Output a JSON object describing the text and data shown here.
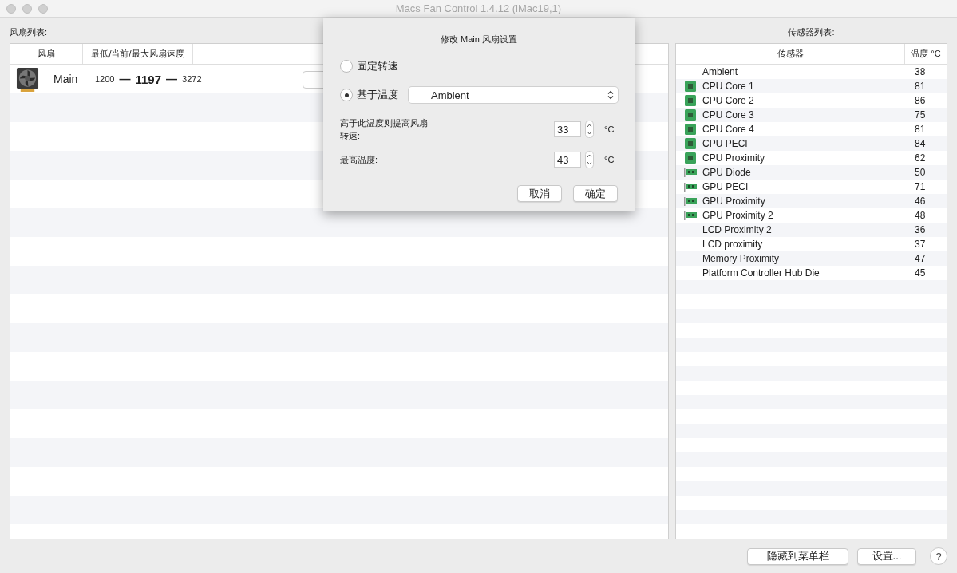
{
  "window": {
    "title": "Macs Fan Control 1.4.12 (iMac19,1)"
  },
  "fan_list": {
    "label": "风扇列表:",
    "columns": [
      "风扇",
      "最低/当前/最大风扇速度"
    ],
    "rows": [
      {
        "name": "Main",
        "min": "1200",
        "current": "1197",
        "max": "3272",
        "separator_1": "—",
        "separator_2": "—"
      }
    ]
  },
  "sensor_list": {
    "label": "传感器列表:",
    "columns": [
      "传感器",
      "温度 °C"
    ],
    "rows": [
      {
        "kind": "plain",
        "name": "Ambient",
        "value": "38"
      },
      {
        "kind": "cpu",
        "name": "CPU Core 1",
        "value": "81"
      },
      {
        "kind": "cpu",
        "name": "CPU Core 2",
        "value": "86"
      },
      {
        "kind": "cpu",
        "name": "CPU Core 3",
        "value": "75"
      },
      {
        "kind": "cpu",
        "name": "CPU Core 4",
        "value": "81"
      },
      {
        "kind": "cpu",
        "name": "CPU PECI",
        "value": "84"
      },
      {
        "kind": "cpu",
        "name": "CPU Proximity",
        "value": "62"
      },
      {
        "kind": "gpu",
        "name": "GPU Diode",
        "value": "50"
      },
      {
        "kind": "gpu",
        "name": "GPU PECI",
        "value": "71"
      },
      {
        "kind": "gpu",
        "name": "GPU Proximity",
        "value": "46"
      },
      {
        "kind": "gpu",
        "name": "GPU Proximity 2",
        "value": "48"
      },
      {
        "kind": "plain",
        "name": "LCD Proximity 2",
        "value": "36"
      },
      {
        "kind": "plain",
        "name": "LCD proximity",
        "value": "37"
      },
      {
        "kind": "plain",
        "name": "Memory Proximity",
        "value": "47"
      },
      {
        "kind": "plain",
        "name": "Platform Controller Hub Die",
        "value": "45"
      }
    ]
  },
  "dialog": {
    "title": "修改 Main 风扇设置",
    "modes": [
      {
        "label": "固定转速",
        "selected": false
      },
      {
        "label": "基于温度",
        "selected": true
      }
    ],
    "sensor_select": {
      "value": "Ambient"
    },
    "fields": [
      {
        "label": "高于此温度则提高风扇转速:",
        "value": "33",
        "unit": "°C"
      },
      {
        "label": "最高温度:",
        "value": "43",
        "unit": "°C"
      }
    ],
    "buttons": [
      "取消",
      "确定"
    ]
  },
  "footer": {
    "buttons": [
      "隐藏到菜单栏",
      "设置..."
    ],
    "help": "?"
  }
}
